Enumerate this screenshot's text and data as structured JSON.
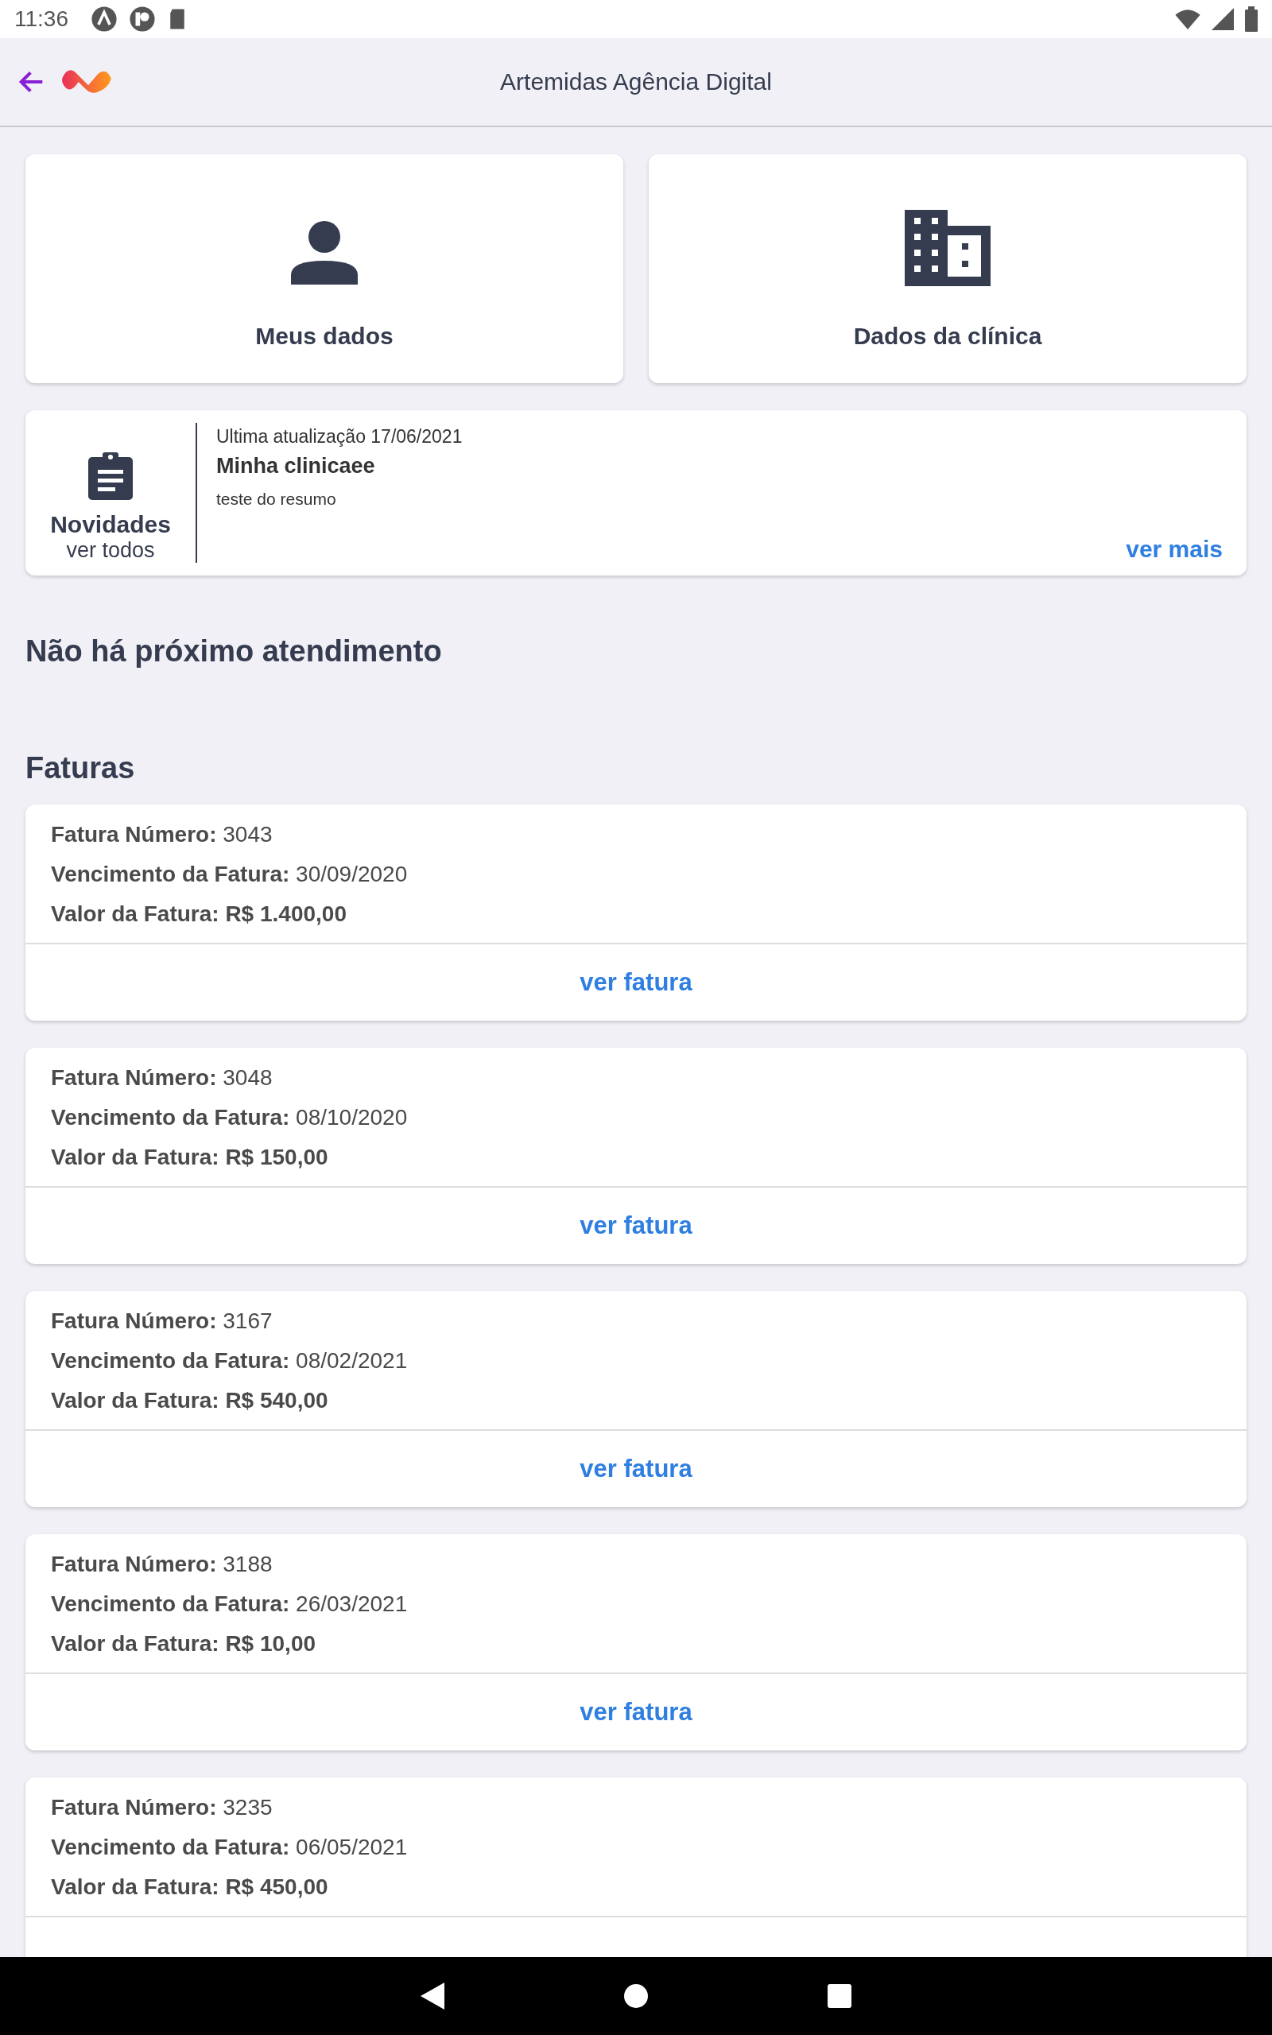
{
  "status_bar": {
    "time": "11:36"
  },
  "header": {
    "title": "Artemidas Agência Digital"
  },
  "shortcuts": [
    {
      "kind": "person",
      "label": "Meus dados"
    },
    {
      "kind": "building",
      "label": "Dados da clínica"
    }
  ],
  "news": {
    "title": "Novidades",
    "link": "ver todos",
    "updated": "Ultima atualização 17/06/2021",
    "headline": "Minha clinicaee",
    "summary": "teste do resumo",
    "more": "ver mais"
  },
  "next_appointment": "Não há próximo atendimento",
  "invoices_title": "Faturas",
  "invoices": [
    {
      "lines": [
        "**Fatura Número:** 3043",
        "**Vencimento da Fatura:** 30/09/2020",
        "**Valor da Fatura: R$ 1.400,00**"
      ],
      "action": "ver fatura"
    },
    {
      "lines": [
        "**Fatura Número:** 3048",
        "**Vencimento da Fatura:** 08/10/2020",
        "**Valor da Fatura: R$ 150,00**"
      ],
      "action": "ver fatura"
    },
    {
      "lines": [
        "**Fatura Número:** 3167",
        "**Vencimento da Fatura:** 08/02/2021",
        "**Valor da Fatura: R$ 540,00**"
      ],
      "action": "ver fatura"
    },
    {
      "lines": [
        "**Fatura Número:** 3188",
        "**Vencimento da Fatura:** 26/03/2021",
        "**Valor da Fatura: R$ 10,00**"
      ],
      "action": "ver fatura"
    },
    {
      "lines": [
        "**Fatura Número:** 3235",
        "**Vencimento da Fatura:** 06/05/2021",
        "**Valor da Fatura: R$ 450,00**"
      ]
    }
  ]
}
